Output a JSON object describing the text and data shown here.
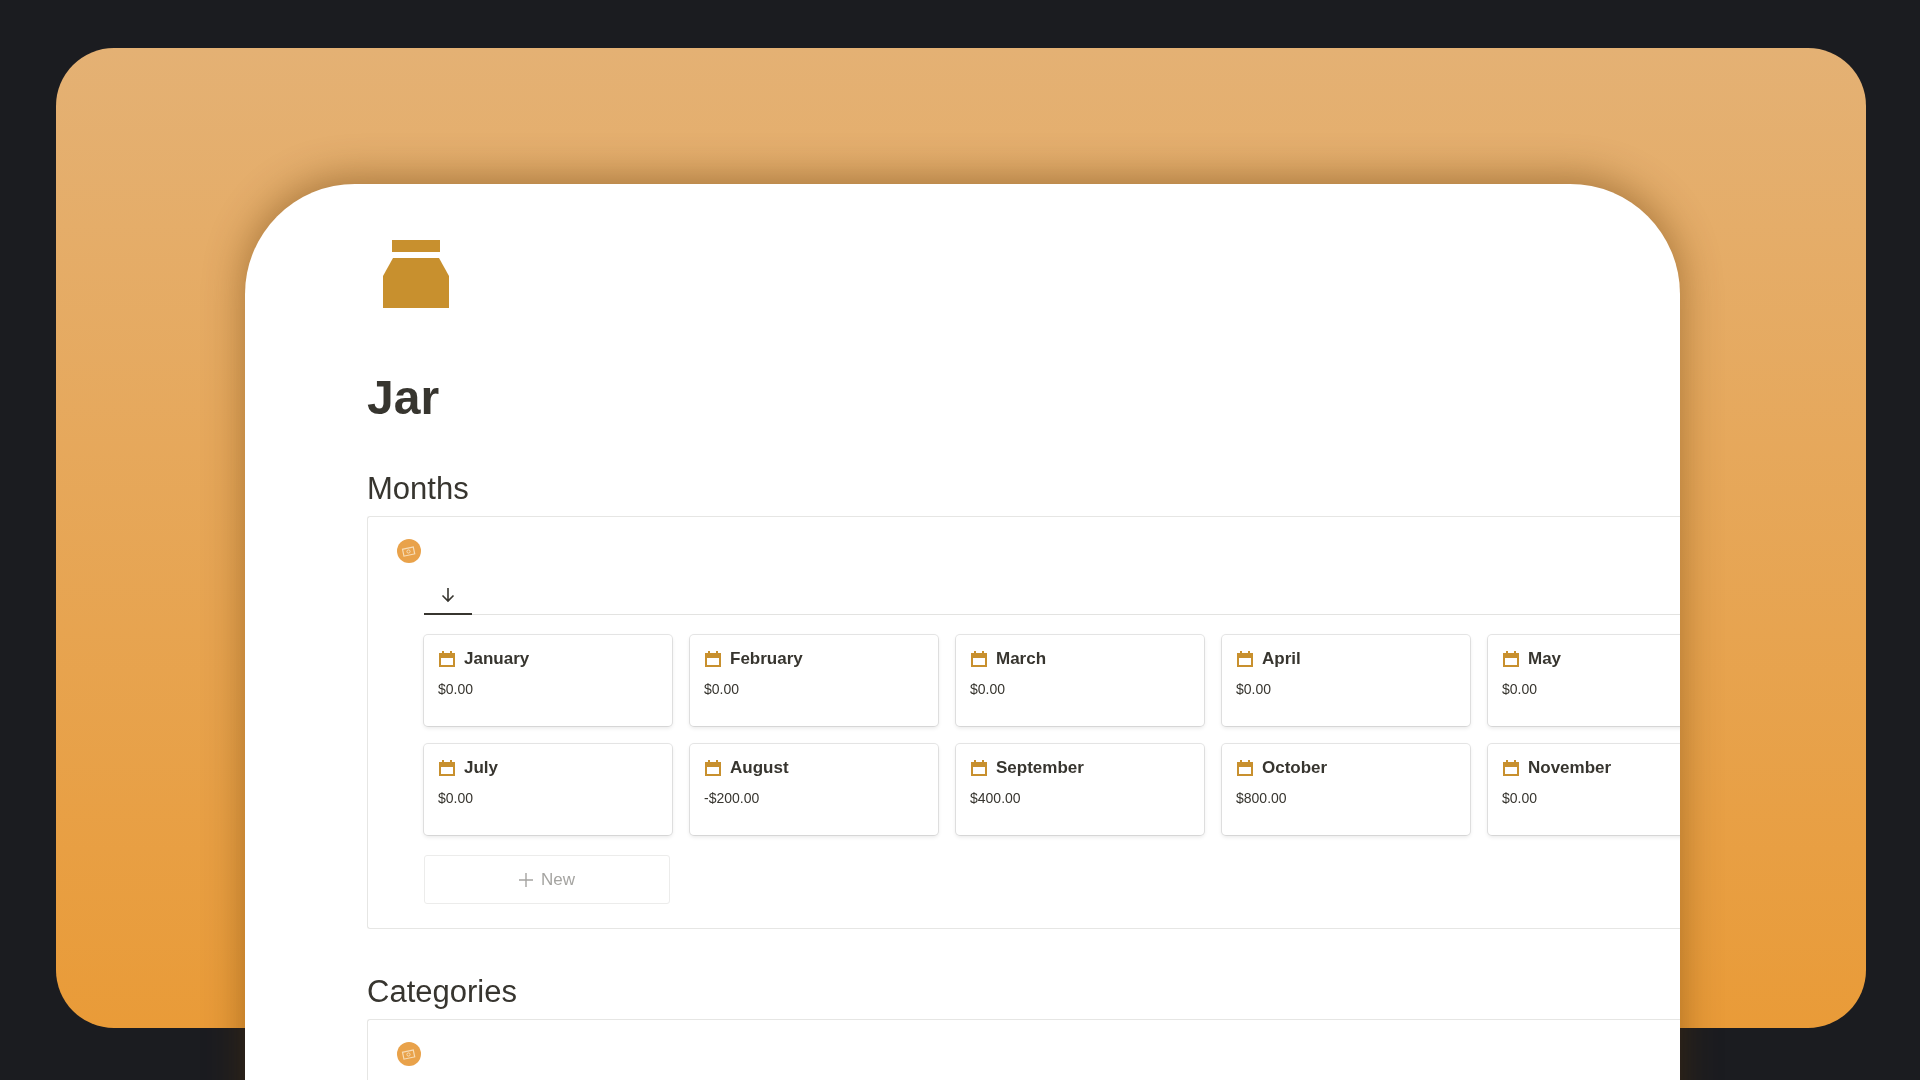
{
  "page": {
    "title": "Jar"
  },
  "sections": [
    {
      "heading": "Months",
      "views": [
        {
          "selected": true
        }
      ],
      "cards": [
        {
          "title": "January",
          "value": "$0.00"
        },
        {
          "title": "February",
          "value": "$0.00"
        },
        {
          "title": "March",
          "value": "$0.00"
        },
        {
          "title": "April",
          "value": "$0.00"
        },
        {
          "title": "May",
          "value": "$0.00"
        },
        {
          "title": "July",
          "value": "$0.00"
        },
        {
          "title": "August",
          "value": "-$200.00"
        },
        {
          "title": "September",
          "value": "$400.00"
        },
        {
          "title": "October",
          "value": "$800.00"
        },
        {
          "title": "November",
          "value": "$0.00"
        }
      ],
      "new_button": "New"
    },
    {
      "heading": "Categories"
    }
  ]
}
